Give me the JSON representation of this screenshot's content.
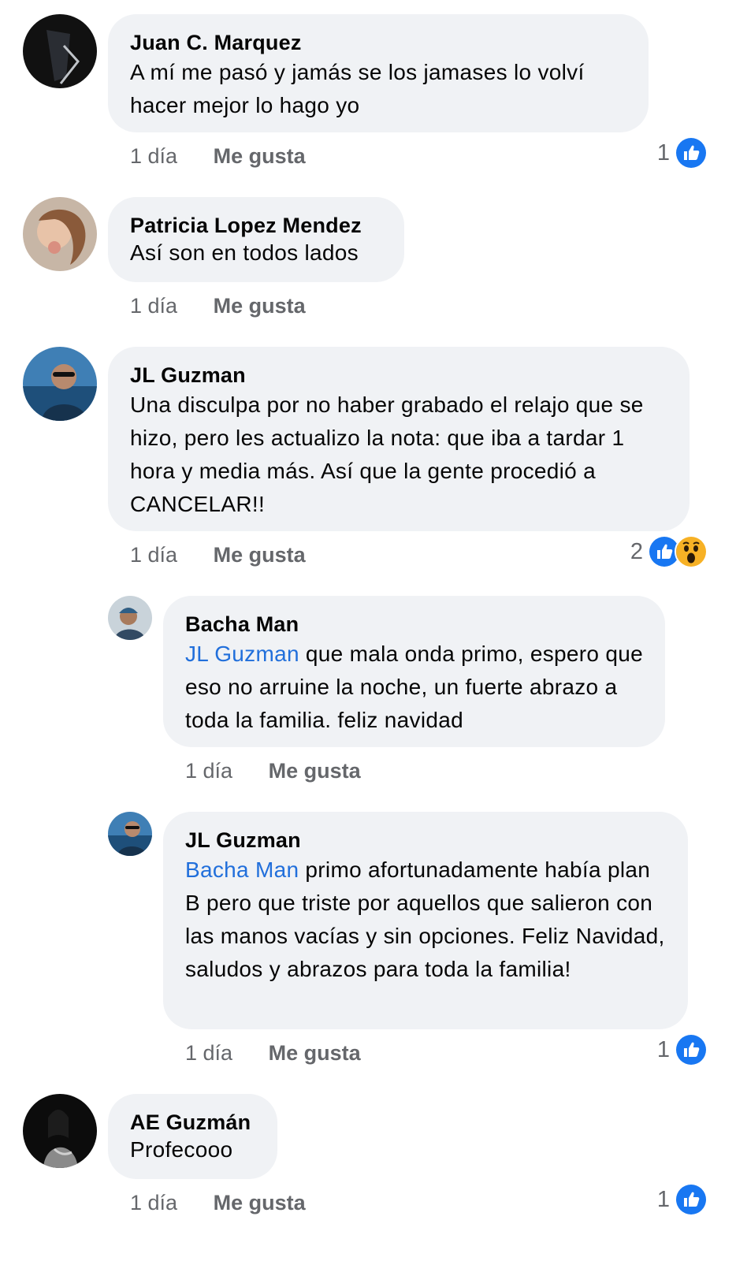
{
  "comments": [
    {
      "author": "Juan C. Marquez",
      "text": "A mí me pasó y jamás se los jamases lo volví hacer mejor lo hago yo",
      "time": "1 día",
      "like_label": "Me gusta",
      "reaction_count": "1"
    },
    {
      "author": "Patricia Lopez Mendez",
      "text": "Así son en todos lados",
      "time": "1 día",
      "like_label": "Me gusta"
    },
    {
      "author": "JL Guzman",
      "text": "Una disculpa por no haber grabado el relajo que se hizo, pero les actualizo la nota: que iba a tardar 1 hora y media más. Así que la gente procedió a CANCELAR!!",
      "time": "1 día",
      "like_label": "Me gusta",
      "reaction_count": "2"
    },
    {
      "author": "Bacha Man",
      "mention": "JL Guzman",
      "text": " que mala onda primo, espero que eso no arruine la noche, un fuerte abrazo a toda la familia. feliz navidad",
      "time": "1 día",
      "like_label": "Me gusta"
    },
    {
      "author": "JL Guzman",
      "mention": "Bacha Man",
      "text": " primo afortunadamente había plan B pero que triste por aquellos que salieron con las manos vacías y sin opciones. Feliz Navidad, saludos y abrazos para toda la familia!",
      "time": "1 día",
      "like_label": "Me gusta",
      "reaction_count": "1"
    },
    {
      "author": "AE Guzmán",
      "text": "Profecooo",
      "time": "1 día",
      "like_label": "Me gusta",
      "reaction_count": "1"
    }
  ],
  "icons": {
    "like": "like-reaction-icon",
    "wow": "wow-reaction-icon"
  },
  "colors": {
    "bubble": "#f0f2f5",
    "mention": "#216fdb",
    "meta": "#65676b",
    "like_blue": "#1877f2",
    "wow_yellow": "#f7b125"
  }
}
